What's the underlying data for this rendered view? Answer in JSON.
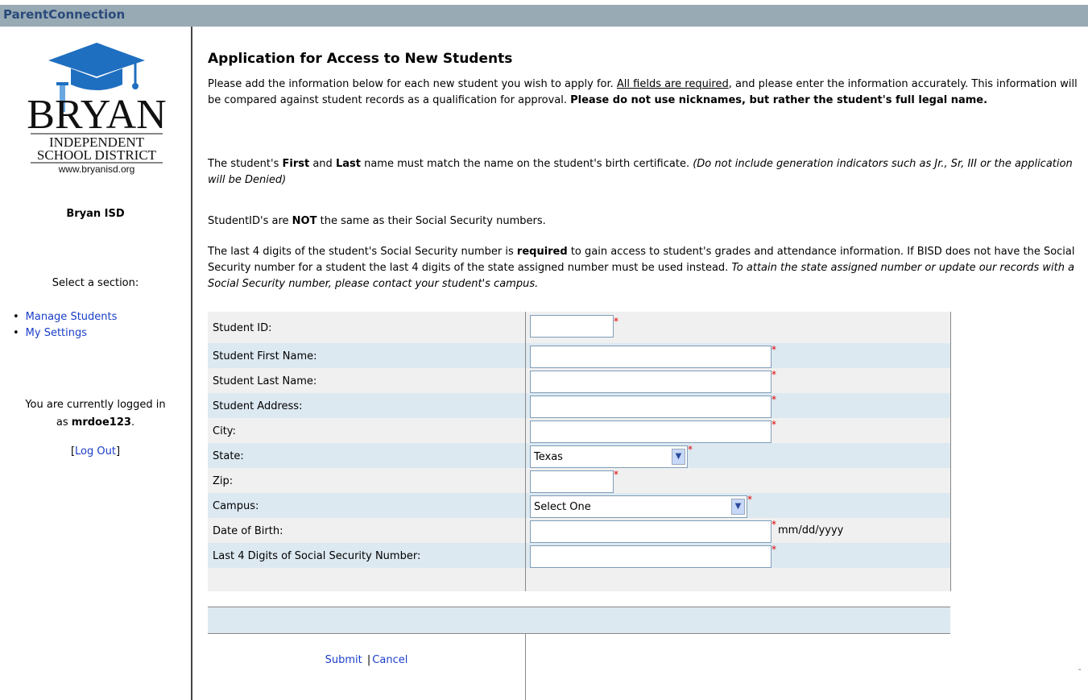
{
  "app": {
    "title": "ParentConnection"
  },
  "sidebar": {
    "logo_text": {
      "name": "BRYAN",
      "line1": "INDEPENDENT",
      "line2": "SCHOOL DISTRICT",
      "url": "www.bryanisd.org"
    },
    "district": "Bryan ISD",
    "select_label": "Select a section:",
    "nav": [
      {
        "label": "Manage Students"
      },
      {
        "label": "My Settings"
      }
    ],
    "login_prefix": "You are currently logged in",
    "login_as": "as",
    "username": "mrdoe123",
    "login_suffix": ".",
    "logout_open": "[",
    "logout_label": "Log Out",
    "logout_close": "]"
  },
  "main": {
    "title": "Application for Access to New Students",
    "p1": {
      "a": "Please add the information below for each new student you wish to apply for.  ",
      "u": "All fields are required",
      "b": ", and please enter the information accurately.  This information will be compared against student records as a qualification for approval.  ",
      "strong": "Please do not use nicknames, but rather the student's full legal name."
    },
    "p2": {
      "a": "The student's ",
      "first": "First",
      "and": " and ",
      "last": "Last",
      "b": " name must match the name on the student's birth certificate. ",
      "em": "(Do not include generation indicators such as Jr., Sr, III or the application will be Denied)"
    },
    "p3": {
      "a": "StudentID's are ",
      "not": "NOT",
      "b": " the same as their Social Security numbers."
    },
    "p4": {
      "a": "The last 4 digits of the student's Social Security number is ",
      "req": "required",
      "b": " to gain access to student's grades and attendance information. If BISD does not have the Social Security number for a student the last 4 digits of the state assigned number must be used instead. ",
      "em": "To attain the state assigned number or update our records with a Social Security number, please contact your student's campus."
    }
  },
  "form": {
    "required_mark": "*",
    "fields": {
      "student_id": {
        "label": "Student ID:",
        "value": ""
      },
      "first_name": {
        "label": "Student First Name:",
        "value": ""
      },
      "last_name": {
        "label": "Student Last Name:",
        "value": ""
      },
      "address": {
        "label": "Student Address:",
        "value": ""
      },
      "city": {
        "label": "City:",
        "value": ""
      },
      "state": {
        "label": "State:",
        "value": "Texas"
      },
      "zip": {
        "label": "Zip:",
        "value": ""
      },
      "campus": {
        "label": "Campus:",
        "value": "Select One"
      },
      "dob": {
        "label": "Date of Birth:",
        "value": "",
        "hint": "mm/dd/yyyy"
      },
      "ssn4": {
        "label": "Last 4 Digits of Social Security Number:",
        "value": ""
      }
    },
    "submit_label": "Submit",
    "separator": "|",
    "cancel_label": "Cancel"
  },
  "colors": {
    "topbar": "#98aab4",
    "brand": "#2a4a7a",
    "row_alt": "#dde9f1",
    "row_plain": "#f0f0f0",
    "link": "#1a3ec8",
    "required": "#e00000"
  }
}
